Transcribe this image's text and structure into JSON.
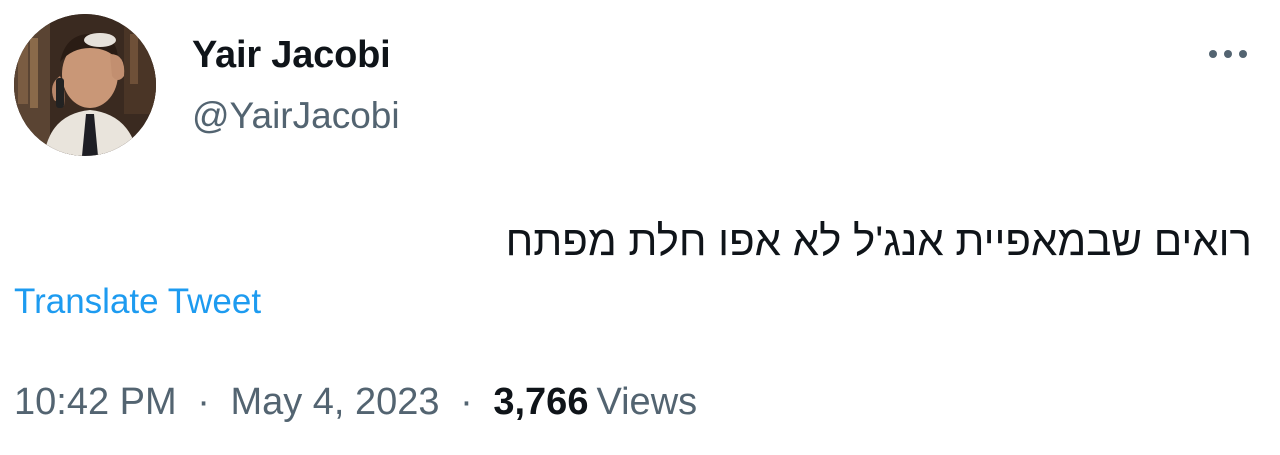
{
  "author": {
    "name": "Yair Jacobi",
    "handle": "@YairJacobi",
    "avatar_icon": "user-avatar-photo"
  },
  "tweet": {
    "text": "רואים שבמאפיית אנג'ל לא אפו חלת מפתח",
    "translate_label": "Translate Tweet",
    "time": "10:42 PM",
    "date": "May 4, 2023",
    "views_count": "3,766",
    "views_label": "Views",
    "separator": "·"
  },
  "menu": {
    "more_icon": "more-options-icon"
  },
  "colors": {
    "primary_text": "#0f1419",
    "secondary_text": "#536471",
    "link": "#1d9bf0",
    "background": "#ffffff"
  }
}
